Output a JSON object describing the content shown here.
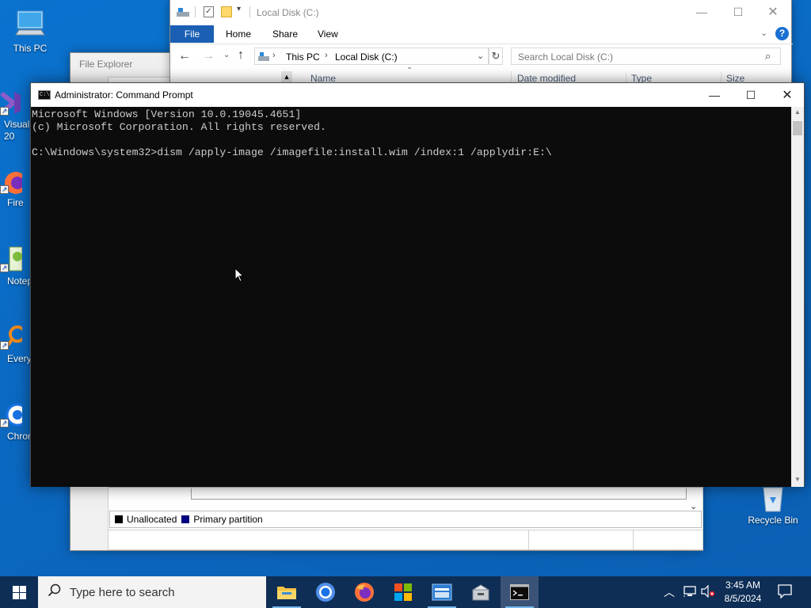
{
  "desktop": {
    "icons": [
      {
        "label": "This PC"
      },
      {
        "label": "Visual\n20"
      },
      {
        "label": "Fire"
      },
      {
        "label": "Notep"
      },
      {
        "label": "Every"
      },
      {
        "label": "Chron"
      },
      {
        "label": "Recycle Bin"
      }
    ]
  },
  "explorer_back": {
    "title": "File Explorer"
  },
  "explorer": {
    "title": "Local Disk (C:)",
    "ribbon_tabs": [
      "File",
      "Home",
      "Share",
      "View"
    ],
    "breadcrumb": [
      "This PC",
      "Local Disk (C:)"
    ],
    "search_placeholder": "Search Local Disk (C:)",
    "columns": [
      "Name",
      "Date modified",
      "Type",
      "Size"
    ]
  },
  "disk_mgmt": {
    "legend": [
      {
        "label": "Unallocated",
        "color": "#000000"
      },
      {
        "label": "Primary partition",
        "color": "#000080"
      }
    ]
  },
  "cmd": {
    "title": "Administrator: Command Prompt",
    "lines": [
      "Microsoft Windows [Version 10.0.19045.4651]",
      "(c) Microsoft Corporation. All rights reserved.",
      "",
      "C:\\Windows\\system32>dism /apply-image /imagefile:install.wim /index:1 /applydir:E:\\"
    ]
  },
  "taskbar": {
    "search_placeholder": "Type here to search",
    "time": "3:45 AM",
    "date": "8/5/2024",
    "apps": [
      "file-explorer",
      "chrome",
      "firefox",
      "store",
      "disk-management",
      "setup",
      "command-prompt"
    ]
  },
  "colors": {
    "desktop": "#0b67bf",
    "taskbar": "#0e2e56",
    "accent": "#1a5fb4"
  }
}
